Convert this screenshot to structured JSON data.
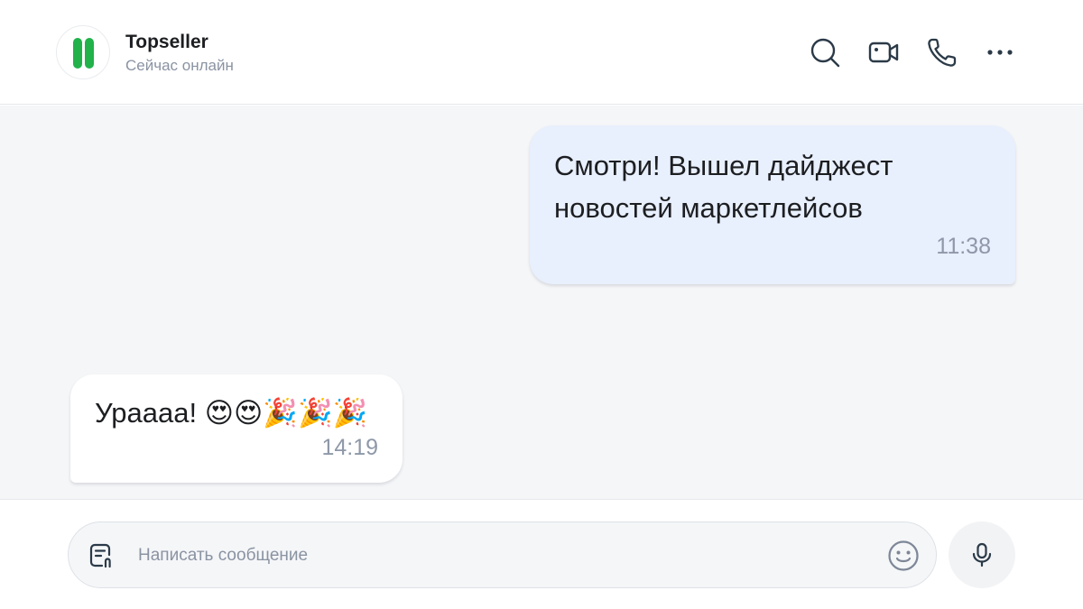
{
  "contact": {
    "name": "Topseller",
    "status": "Сейчас онлайн",
    "avatar_color": "#21b24a"
  },
  "header_actions": [
    {
      "icon": "search-icon",
      "label": "Search"
    },
    {
      "icon": "video-call-icon",
      "label": "Video call"
    },
    {
      "icon": "phone-icon",
      "label": "Voice call"
    },
    {
      "icon": "more-icon",
      "label": "More"
    }
  ],
  "messages": [
    {
      "direction": "outgoing",
      "text": "Смотри! Вышел дайджест\nновостей маркетлейсов",
      "time": "11:38"
    },
    {
      "direction": "incoming",
      "text": "Урaaaa! 😍😍🎉🎉🎉",
      "time": "14:19"
    }
  ],
  "composer": {
    "placeholder": "Написать сообщение",
    "value": ""
  },
  "colors": {
    "outgoing_bubble": "#e8effd",
    "incoming_bubble": "#ffffff",
    "chat_background": "#f5f6f8",
    "icon_color": "#2b3a48",
    "muted_text": "#8a93a2"
  }
}
